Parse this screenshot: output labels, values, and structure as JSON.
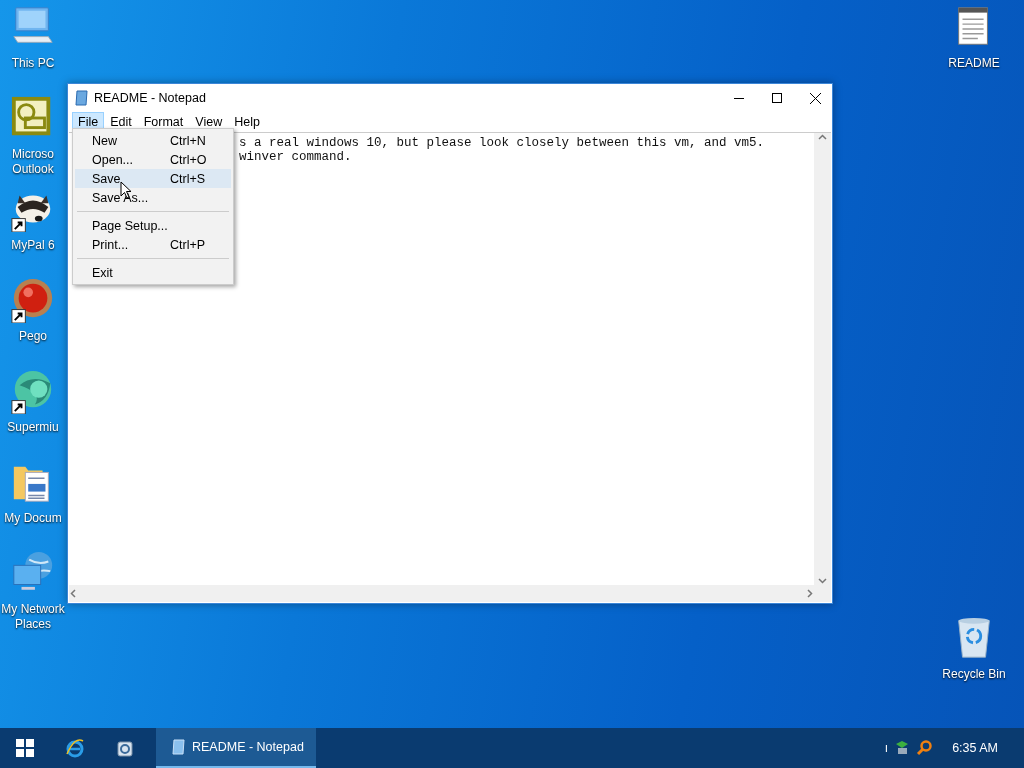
{
  "desktop_icons_left": [
    {
      "kind": "computer",
      "lines": [
        "This PC"
      ],
      "shortcut": false
    },
    {
      "kind": "mail",
      "lines": [
        "Microso",
        "Outlook"
      ],
      "shortcut": false
    },
    {
      "kind": "raccoon",
      "lines": [
        "MyPal 6"
      ],
      "shortcut": true
    },
    {
      "kind": "ball",
      "lines": [
        "Pego"
      ],
      "shortcut": true
    },
    {
      "kind": "sphere",
      "lines": [
        "Supermiu"
      ],
      "shortcut": true
    },
    {
      "kind": "folder",
      "lines": [
        "My Docum"
      ],
      "shortcut": false
    },
    {
      "kind": "network",
      "lines": [
        "My Network",
        "Places"
      ],
      "shortcut": false
    }
  ],
  "desktop_icons_right": [
    {
      "kind": "notepad",
      "lines": [
        "README"
      ],
      "shortcut": false
    },
    {
      "kind": "recycle",
      "lines": [
        "Recycle Bin"
      ],
      "shortcut": false
    }
  ],
  "window": {
    "title": "README - Notepad",
    "menu_bar": [
      {
        "label": "File",
        "selected": true
      },
      {
        "label": "Edit",
        "selected": false
      },
      {
        "label": "Format",
        "selected": false
      },
      {
        "label": "View",
        "selected": false
      },
      {
        "label": "Help",
        "selected": false
      }
    ],
    "text_lines": [
      "s a real windows 10, but please look closely between this vm, and vm5.",
      "winver command."
    ],
    "file_menu": [
      {
        "kind": "item",
        "label": "New",
        "shortcut": "Ctrl+N",
        "selected": false
      },
      {
        "kind": "item",
        "label": "Open...",
        "shortcut": "Ctrl+O",
        "selected": false
      },
      {
        "kind": "item",
        "label": "Save",
        "shortcut": "Ctrl+S",
        "selected": true
      },
      {
        "kind": "item",
        "label": "Save As...",
        "selected": false
      },
      {
        "kind": "separator"
      },
      {
        "kind": "item",
        "label": "Page Setup...",
        "selected": false
      },
      {
        "kind": "item",
        "label": "Print...",
        "shortcut": "Ctrl+P",
        "selected": false
      },
      {
        "kind": "separator"
      },
      {
        "kind": "item",
        "label": "Exit",
        "selected": false
      }
    ]
  },
  "taskbar": {
    "pinned": [
      {
        "kind": "browser"
      },
      {
        "kind": "app"
      }
    ],
    "tasks": [
      {
        "label": "README - Notepad",
        "selected": true
      }
    ],
    "tray_text": "ı",
    "clock": "6:35 AM"
  }
}
